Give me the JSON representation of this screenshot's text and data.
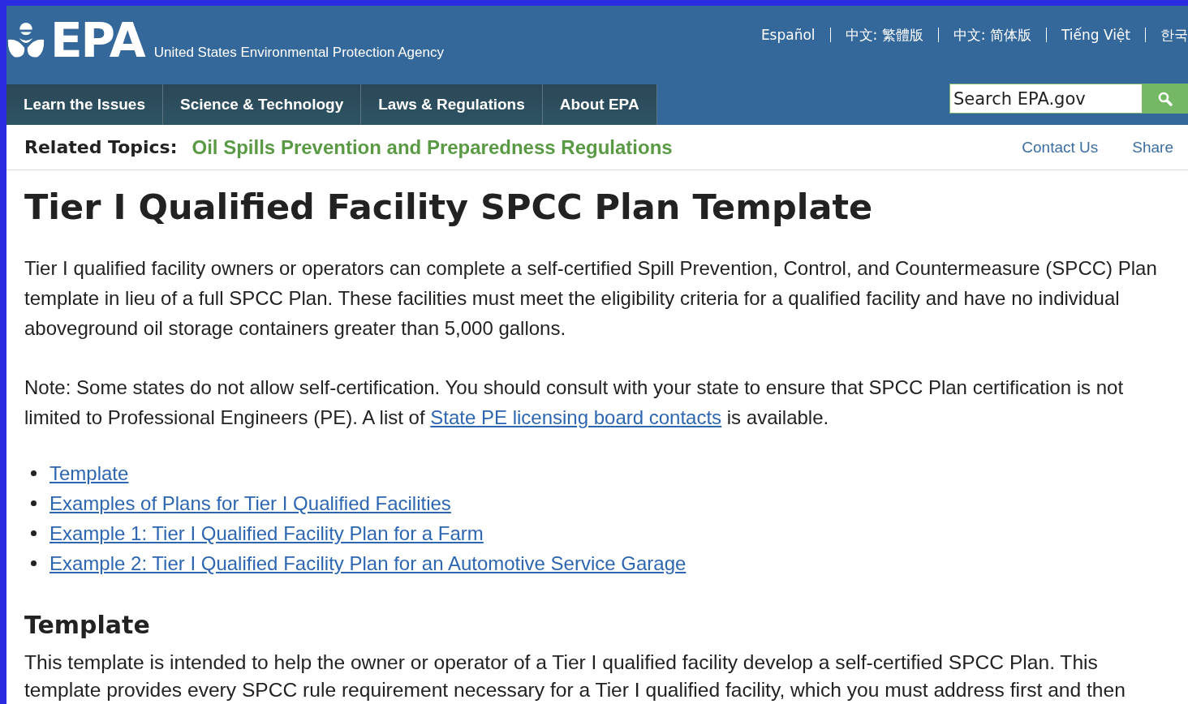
{
  "header": {
    "logo": "EPA",
    "agency": "United States Environmental Protection Agency",
    "languages": [
      "Español",
      "中文: 繁體版",
      "中文: 简体版",
      "Tiếng Việt",
      "한국"
    ],
    "nav": [
      {
        "label": "Learn the Issues"
      },
      {
        "label": "Science & Technology"
      },
      {
        "label": "Laws & Regulations"
      },
      {
        "label": "About EPA"
      }
    ],
    "search": {
      "placeholder": "Search EPA.gov"
    }
  },
  "related": {
    "label": "Related Topics:",
    "topic": "Oil Spills Prevention and Preparedness Regulations",
    "links": [
      "Contact Us",
      "Share"
    ]
  },
  "title": "Tier I Qualified Facility SPCC Plan Template",
  "intro": "Tier I qualified facility owners or operators can complete a self-certified Spill Prevention, Control, and Countermeasure (SPCC) Plan template in lieu of a full SPCC Plan. These facilities must meet the eligibility criteria for a qualified facility and have no individual aboveground oil storage containers greater than 5,000 gallons.",
  "note": {
    "before": "Note: Some states do not allow self-certification. You should consult with your state to ensure that SPCC Plan certification is not limited to Professional Engineers (PE). A list of",
    "link": "State PE licensing board contacts",
    "after": "is available."
  },
  "list": [
    "Template",
    "Examples of Plans for Tier I Qualified Facilities",
    "Example 1: Tier I Qualified Facility Plan for a Farm",
    "Example 2: Tier I Qualified Facility Plan for an Automotive Service Garage"
  ],
  "section": {
    "heading": "Template",
    "text": "This template is intended to help the owner or operator of a Tier I qualified facility develop a self-certified SPCC Plan. This template provides every SPCC rule requirement necessary for a Tier I qualified facility, which you must address first and then"
  }
}
